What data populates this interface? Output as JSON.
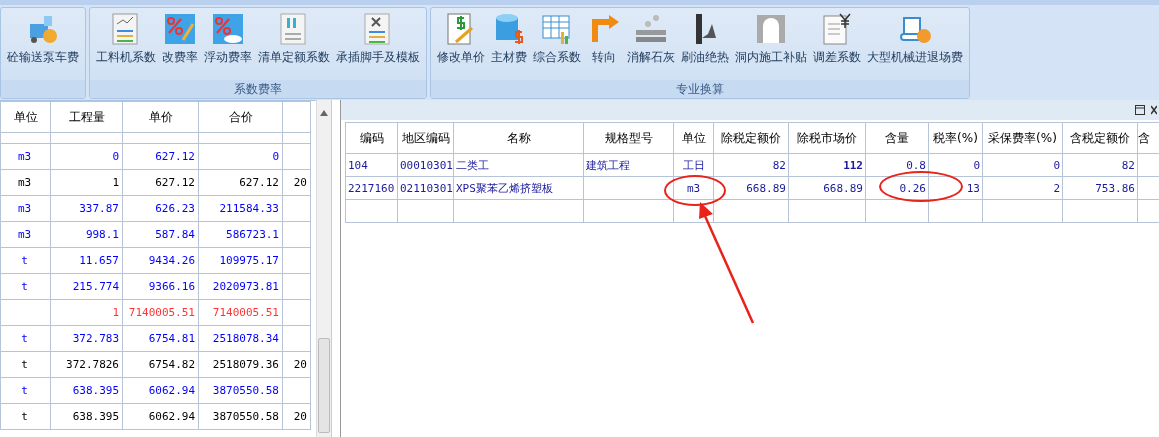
{
  "ribbon": {
    "groups": [
      {
        "buttons": [
          "砼输送泵车费"
        ]
      },
      {
        "label": "系数费率",
        "buttons": [
          "工料机系数",
          "改费率",
          "浮动费率",
          "清单定额系数",
          "承插脚手及模板"
        ]
      },
      {
        "label": "专业换算",
        "buttons": [
          "修改单价",
          "主材费",
          "综合系数",
          "转向",
          "消解石灰",
          "刷油绝热",
          "洞内施工补贴",
          "调差系数",
          "大型机械进退场费"
        ]
      }
    ]
  },
  "left_table": {
    "columns": [
      "单位",
      "工程量",
      "单价",
      "合价"
    ],
    "rows": [
      {
        "cells": [
          "m3",
          "0",
          "627.12",
          "0"
        ],
        "color": "#0000ff"
      },
      {
        "cells": [
          "m3",
          "1",
          "627.12",
          "627.12",
          "20"
        ],
        "color": "#000000"
      },
      {
        "cells": [
          "m3",
          "337.87",
          "626.23",
          "211584.33"
        ],
        "color": "#0000ff"
      },
      {
        "cells": [
          "m3",
          "998.1",
          "587.84",
          "586723.1"
        ],
        "color": "#0000ff"
      },
      {
        "cells": [
          "t",
          "11.657",
          "9434.26",
          "109975.17"
        ],
        "color": "#0000ff"
      },
      {
        "cells": [
          "t",
          "215.774",
          "9366.16",
          "2020973.81"
        ],
        "color": "#0000ff"
      },
      {
        "cells": [
          "",
          "1",
          "7140005.51",
          "7140005.51"
        ],
        "color": "#ff3333"
      },
      {
        "cells": [
          "t",
          "372.783",
          "6754.81",
          "2518078.34"
        ],
        "color": "#0000ff"
      },
      {
        "cells": [
          "t",
          "372.7826",
          "6754.82",
          "2518079.36",
          "20"
        ],
        "color": "#000000"
      },
      {
        "cells": [
          "t",
          "638.395",
          "6062.94",
          "3870550.58"
        ],
        "color": "#0000ff"
      },
      {
        "cells": [
          "t",
          "638.395",
          "6062.94",
          "3870550.58",
          "20"
        ],
        "color": "#000000"
      }
    ]
  },
  "right_table": {
    "columns": [
      "编码",
      "地区编码",
      "名称",
      "规格型号",
      "单位",
      "除税定额价",
      "除税市场价",
      "含量",
      "税率(%)",
      "采保费率(%)",
      "含税定额价",
      "含"
    ],
    "rows": [
      {
        "cells": [
          "104",
          "00010301",
          "二类工",
          "建筑工程",
          "工日",
          "82",
          "**112**",
          "0.8",
          "0",
          "0",
          "82",
          ""
        ]
      },
      {
        "cells": [
          "2217160",
          "02110301",
          "XPS聚苯乙烯挤塑板",
          "",
          "m3",
          "668.89",
          "668.89",
          "0.26",
          "13",
          "2",
          "753.86",
          ""
        ]
      }
    ]
  }
}
